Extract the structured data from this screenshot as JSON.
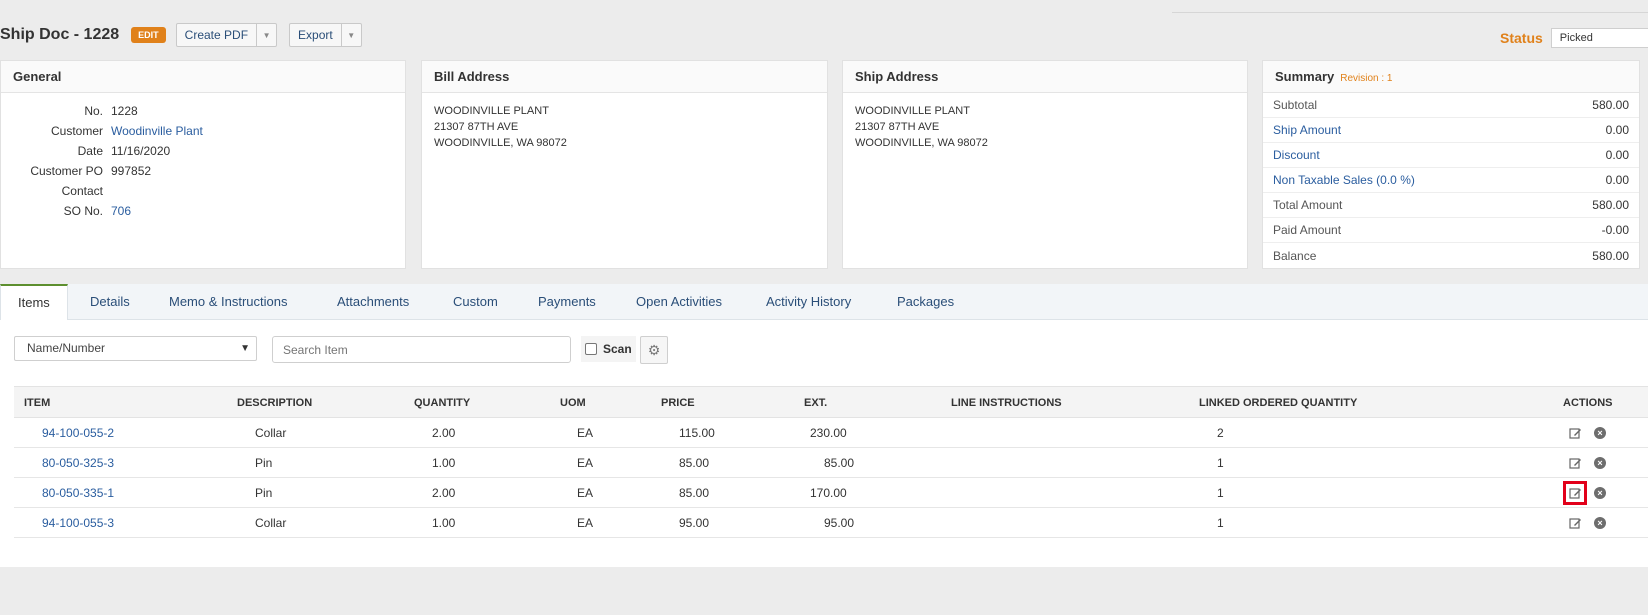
{
  "header": {
    "title": "Ship Doc - 1228",
    "edit_badge": "EDIT",
    "create_pdf_label": "Create PDF",
    "export_label": "Export",
    "status_label": "Status",
    "status_value": "Picked"
  },
  "general": {
    "title": "General",
    "rows": [
      {
        "k": "No.",
        "v": "1228"
      },
      {
        "k": "Customer",
        "v": "Woodinville Plant"
      },
      {
        "k": "Date",
        "v": "11/16/2020"
      },
      {
        "k": "Customer PO",
        "v": "997852"
      },
      {
        "k": "Contact",
        "v": ""
      },
      {
        "k": "SO No.",
        "v": "706"
      }
    ]
  },
  "bill_address": {
    "title": "Bill Address",
    "lines": [
      "WOODINVILLE PLANT",
      "21307 87TH AVE",
      "WOODINVILLE, WA 98072"
    ]
  },
  "ship_address": {
    "title": "Ship Address",
    "lines": [
      "WOODINVILLE PLANT",
      "21307 87TH AVE",
      "WOODINVILLE, WA 98072"
    ]
  },
  "summary": {
    "title": "Summary",
    "revision": "Revision : 1",
    "rows": [
      {
        "k": "Subtotal",
        "v": "580.00"
      },
      {
        "k": "Ship Amount",
        "v": "0.00"
      },
      {
        "k": "Discount",
        "v": "0.00"
      },
      {
        "k": "Non Taxable Sales (0.0 %)",
        "v": "0.00"
      },
      {
        "k": "Total Amount",
        "v": "580.00"
      },
      {
        "k": "Paid Amount",
        "v": "-0.00"
      },
      {
        "k": "Balance",
        "v": "580.00"
      }
    ]
  },
  "tabs": [
    "Items",
    "Details",
    "Memo & Instructions",
    "Attachments",
    "Custom",
    "Payments",
    "Open Activities",
    "Activity History",
    "Packages"
  ],
  "filters": {
    "select_value": "Name/Number",
    "search_placeholder": "Search Item",
    "scan_label": "Scan"
  },
  "grid": {
    "columns": [
      "ITEM",
      "DESCRIPTION",
      "QUANTITY",
      "UOM",
      "PRICE",
      "EXT.",
      "LINE INSTRUCTIONS",
      "LINKED ORDERED QUANTITY",
      "ACTIONS"
    ],
    "rows": [
      {
        "item": "94-100-055-2",
        "desc": "Collar",
        "qty": "2.00",
        "uom": "EA",
        "price": "115.00",
        "ext": "230.00",
        "instr": "",
        "linked": "2"
      },
      {
        "item": "80-050-325-3",
        "desc": "Pin",
        "qty": "1.00",
        "uom": "EA",
        "price": "85.00",
        "ext": "85.00",
        "instr": "",
        "linked": "1"
      },
      {
        "item": "80-050-335-1",
        "desc": "Pin",
        "qty": "2.00",
        "uom": "EA",
        "price": "85.00",
        "ext": "170.00",
        "instr": "",
        "linked": "1"
      },
      {
        "item": "94-100-055-3",
        "desc": "Collar",
        "qty": "1.00",
        "uom": "EA",
        "price": "95.00",
        "ext": "95.00",
        "instr": "",
        "linked": "1"
      }
    ]
  },
  "colors": {
    "accent": "#e0811a",
    "link": "#2a5d9f",
    "highlight": "#e2001a"
  }
}
